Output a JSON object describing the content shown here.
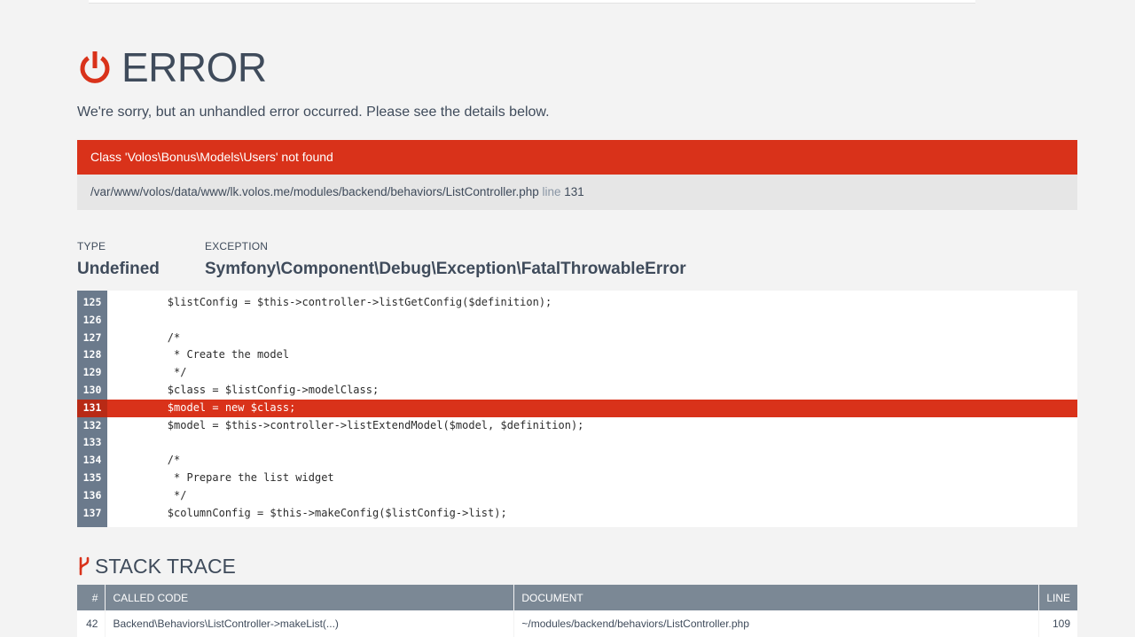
{
  "header": {
    "title": "ERROR",
    "subtitle": "We're sorry, but an unhandled error occurred. Please see the details below."
  },
  "error": {
    "message": "Class 'Volos\\Bonus\\Models\\Users' not found",
    "file_path": "/var/www/volos/data/www/lk.volos.me/modules/backend/behaviors/ListController.php",
    "line_label": "line",
    "line_number": "131"
  },
  "details": {
    "type_label": "TYPE",
    "type_value": "Undefined",
    "exception_label": "EXCEPTION",
    "exception_value": "Symfony\\Component\\Debug\\Exception\\FatalThrowableError"
  },
  "code": {
    "highlight_line": "131",
    "lines": [
      {
        "num": "125",
        "text": "        $listConfig = $this->controller->listGetConfig($definition);"
      },
      {
        "num": "126",
        "text": ""
      },
      {
        "num": "127",
        "text": "        /*"
      },
      {
        "num": "128",
        "text": "         * Create the model"
      },
      {
        "num": "129",
        "text": "         */"
      },
      {
        "num": "130",
        "text": "        $class = $listConfig->modelClass;"
      },
      {
        "num": "131",
        "text": "        $model = new $class;"
      },
      {
        "num": "132",
        "text": "        $model = $this->controller->listExtendModel($model, $definition);"
      },
      {
        "num": "133",
        "text": ""
      },
      {
        "num": "134",
        "text": "        /*"
      },
      {
        "num": "135",
        "text": "         * Prepare the list widget"
      },
      {
        "num": "136",
        "text": "         */"
      },
      {
        "num": "137",
        "text": "        $columnConfig = $this->makeConfig($listConfig->list);"
      }
    ]
  },
  "stack_trace": {
    "title": "STACK TRACE",
    "columns": {
      "num": "#",
      "called": "CALLED CODE",
      "document": "DOCUMENT",
      "line": "LINE"
    },
    "rows": [
      {
        "num": "42",
        "called": "Backend\\Behaviors\\ListController->makeList(...)",
        "document": "~/modules/backend/behaviors/ListController.php",
        "line": "109"
      }
    ]
  },
  "colors": {
    "accent": "#d9321a",
    "gutter": "#6b7a8c",
    "table_header": "#7b8895"
  },
  "icons": {
    "title_icon": "power-icon",
    "stack_icon": "branch-icon"
  }
}
